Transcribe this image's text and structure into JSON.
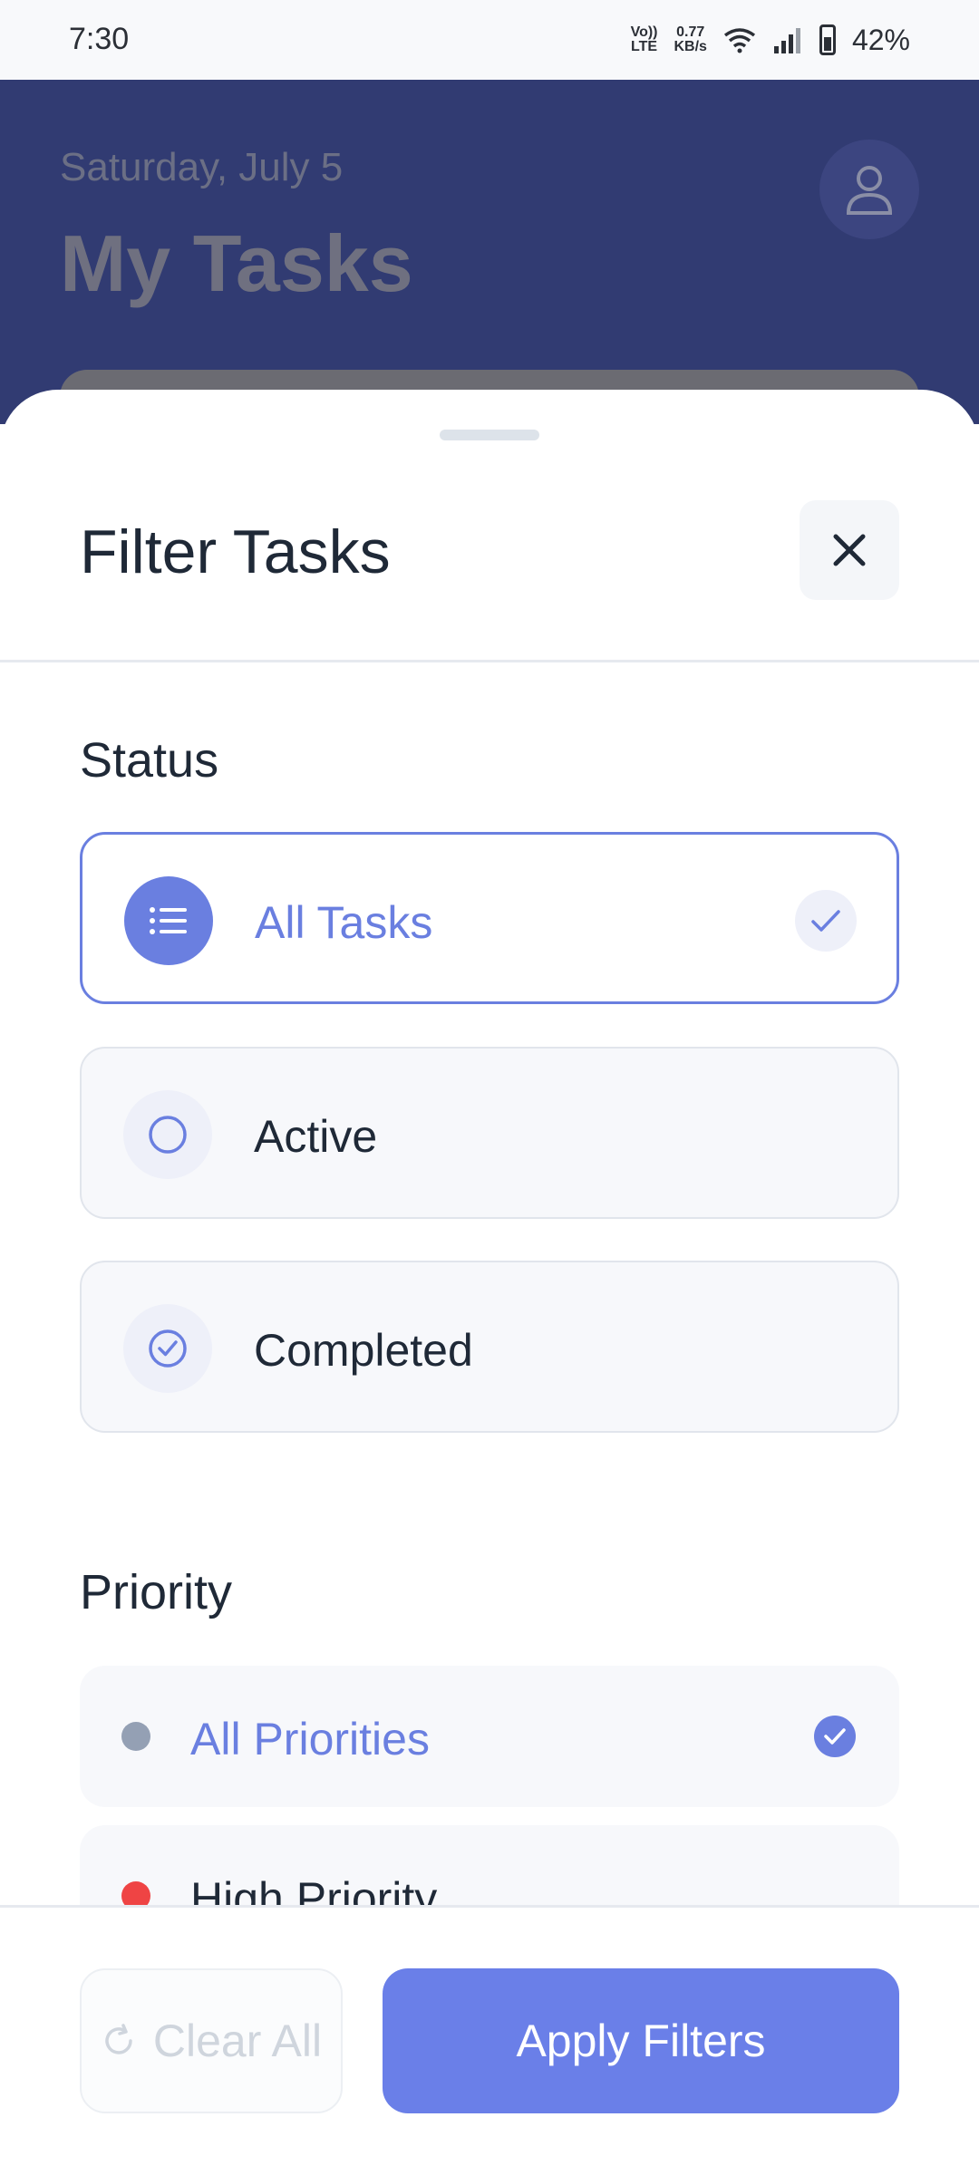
{
  "status_bar": {
    "time": "7:30",
    "network_top": "Vo))",
    "network_bottom": "LTE",
    "speed_value": "0.77",
    "speed_unit": "KB/s",
    "battery": "42%"
  },
  "header": {
    "date": "Saturday, July 5",
    "title": "My Tasks",
    "avatar_icon": "user-icon"
  },
  "sheet": {
    "title": "Filter Tasks",
    "close_icon": "close-icon",
    "status_section": {
      "label": "Status",
      "options": [
        {
          "label": "All Tasks",
          "icon": "list-icon",
          "selected": true
        },
        {
          "label": "Active",
          "icon": "circle-icon",
          "selected": false
        },
        {
          "label": "Completed",
          "icon": "check-circle-icon",
          "selected": false
        }
      ]
    },
    "priority_section": {
      "label": "Priority",
      "options": [
        {
          "label": "All Priorities",
          "dot_color": "#94a0b4",
          "selected": true
        },
        {
          "label": "High Priority",
          "dot_color": "#ef4444",
          "selected": false
        }
      ]
    }
  },
  "footer": {
    "clear_label": "Clear All",
    "apply_label": "Apply Filters"
  },
  "colors": {
    "accent": "#6a7fe0",
    "header_bg": "#313b72",
    "high_priority": "#ef4444"
  }
}
